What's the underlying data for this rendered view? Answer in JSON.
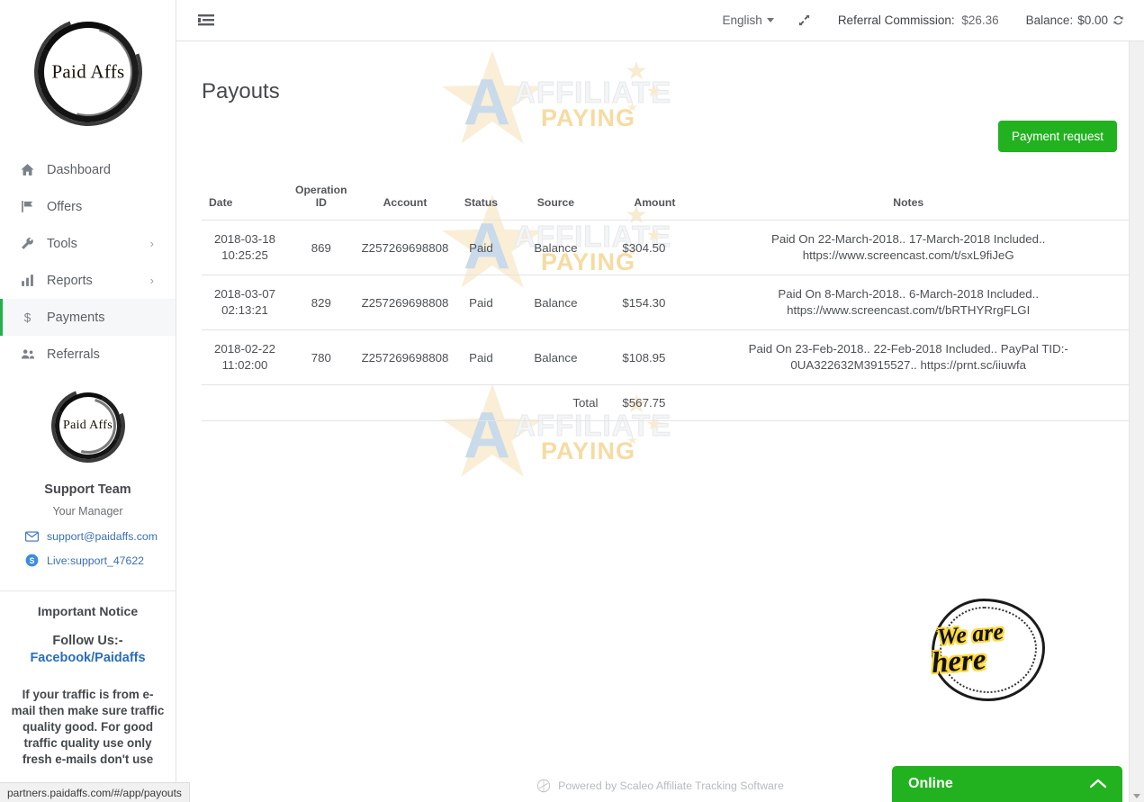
{
  "brand": {
    "logo_text": "Paid Affs"
  },
  "watermark": {
    "line1": "AFFILIATE",
    "line2": "PAYING",
    "letter": "A"
  },
  "topbar": {
    "menu_toggle_icon": "list-toggle-icon",
    "language": "English",
    "expand_icon": "fullscreen-expand-icon",
    "referral_label": "Referral Commission:",
    "referral_value": "$26.36",
    "balance_label": "Balance:",
    "balance_value": "$0.00",
    "refresh_icon": "refresh-icon"
  },
  "sidebar": {
    "items": [
      {
        "label": "Dashboard",
        "icon": "home-icon",
        "chevron": false,
        "active": false
      },
      {
        "label": "Offers",
        "icon": "flag-icon",
        "chevron": false,
        "active": false
      },
      {
        "label": "Tools",
        "icon": "wrench-icon",
        "chevron": true,
        "active": false
      },
      {
        "label": "Reports",
        "icon": "bar-chart-icon",
        "chevron": true,
        "active": false
      },
      {
        "label": "Payments",
        "icon": "dollar-icon",
        "chevron": false,
        "active": true
      },
      {
        "label": "Referrals",
        "icon": "users-icon",
        "chevron": false,
        "active": false
      }
    ],
    "chevron_glyph": "›",
    "support": {
      "title": "Support Team",
      "subtitle": "Your Manager",
      "email": "support@paidaffs.com",
      "skype": "Live:support_47622"
    },
    "notice": {
      "title": "Important Notice",
      "follow_prefix": "Follow Us:-",
      "follow_link": "Facebook/Paidaffs",
      "body": "If your traffic is from e-mail then make sure traffic quality good. For good traffic quality use only fresh e-mails don't use"
    }
  },
  "main": {
    "page_title": "Payouts",
    "payment_request_button": "Payment request",
    "table": {
      "headers": [
        "Date",
        "Operation ID",
        "Account",
        "Status",
        "Source",
        "Amount",
        "Notes"
      ],
      "rows": [
        {
          "date": "2018-03-18",
          "time": "10:25:25",
          "operation_id": "869",
          "account": "Z257269698808",
          "status": "Paid",
          "source": "Balance",
          "amount": "$304.50",
          "note_line1": "Paid On 22-March-2018.. 17-March-2018 Included..",
          "note_line2": "https://www.screencast.com/t/sxL9fiJeG"
        },
        {
          "date": "2018-03-07",
          "time": "02:13:21",
          "operation_id": "829",
          "account": "Z257269698808",
          "status": "Paid",
          "source": "Balance",
          "amount": "$154.30",
          "note_line1": "Paid On 8-March-2018.. 6-March-2018 Included..",
          "note_line2": "https://www.screencast.com/t/bRTHYRrgFLGI"
        },
        {
          "date": "2018-02-22",
          "time": "11:02:00",
          "operation_id": "780",
          "account": "Z257269698808",
          "status": "Paid",
          "source": "Balance",
          "amount": "$108.95",
          "note_line1": "Paid On 23-Feb-2018.. 22-Feb-2018 Included.. PayPal TID:-",
          "note_line2": "0UA322632M3915527.. https://prnt.sc/iiuwfa"
        }
      ],
      "total_label": "Total",
      "total_amount": "$567.75"
    },
    "footer": "Powered by Scaleo Affiliate Tracking Software"
  },
  "chat": {
    "badge_line1": "We are",
    "badge_line2": "here",
    "status": "Online",
    "toggle_icon": "chevron-up-icon"
  },
  "statusbar": {
    "url": "partners.paidaffs.com/#/app/payouts"
  },
  "colors": {
    "accent_green": "#22b21f",
    "status_paid": "#5fa87f",
    "link_blue": "#3a6fb5",
    "chat_yellow": "#ffd93b"
  }
}
